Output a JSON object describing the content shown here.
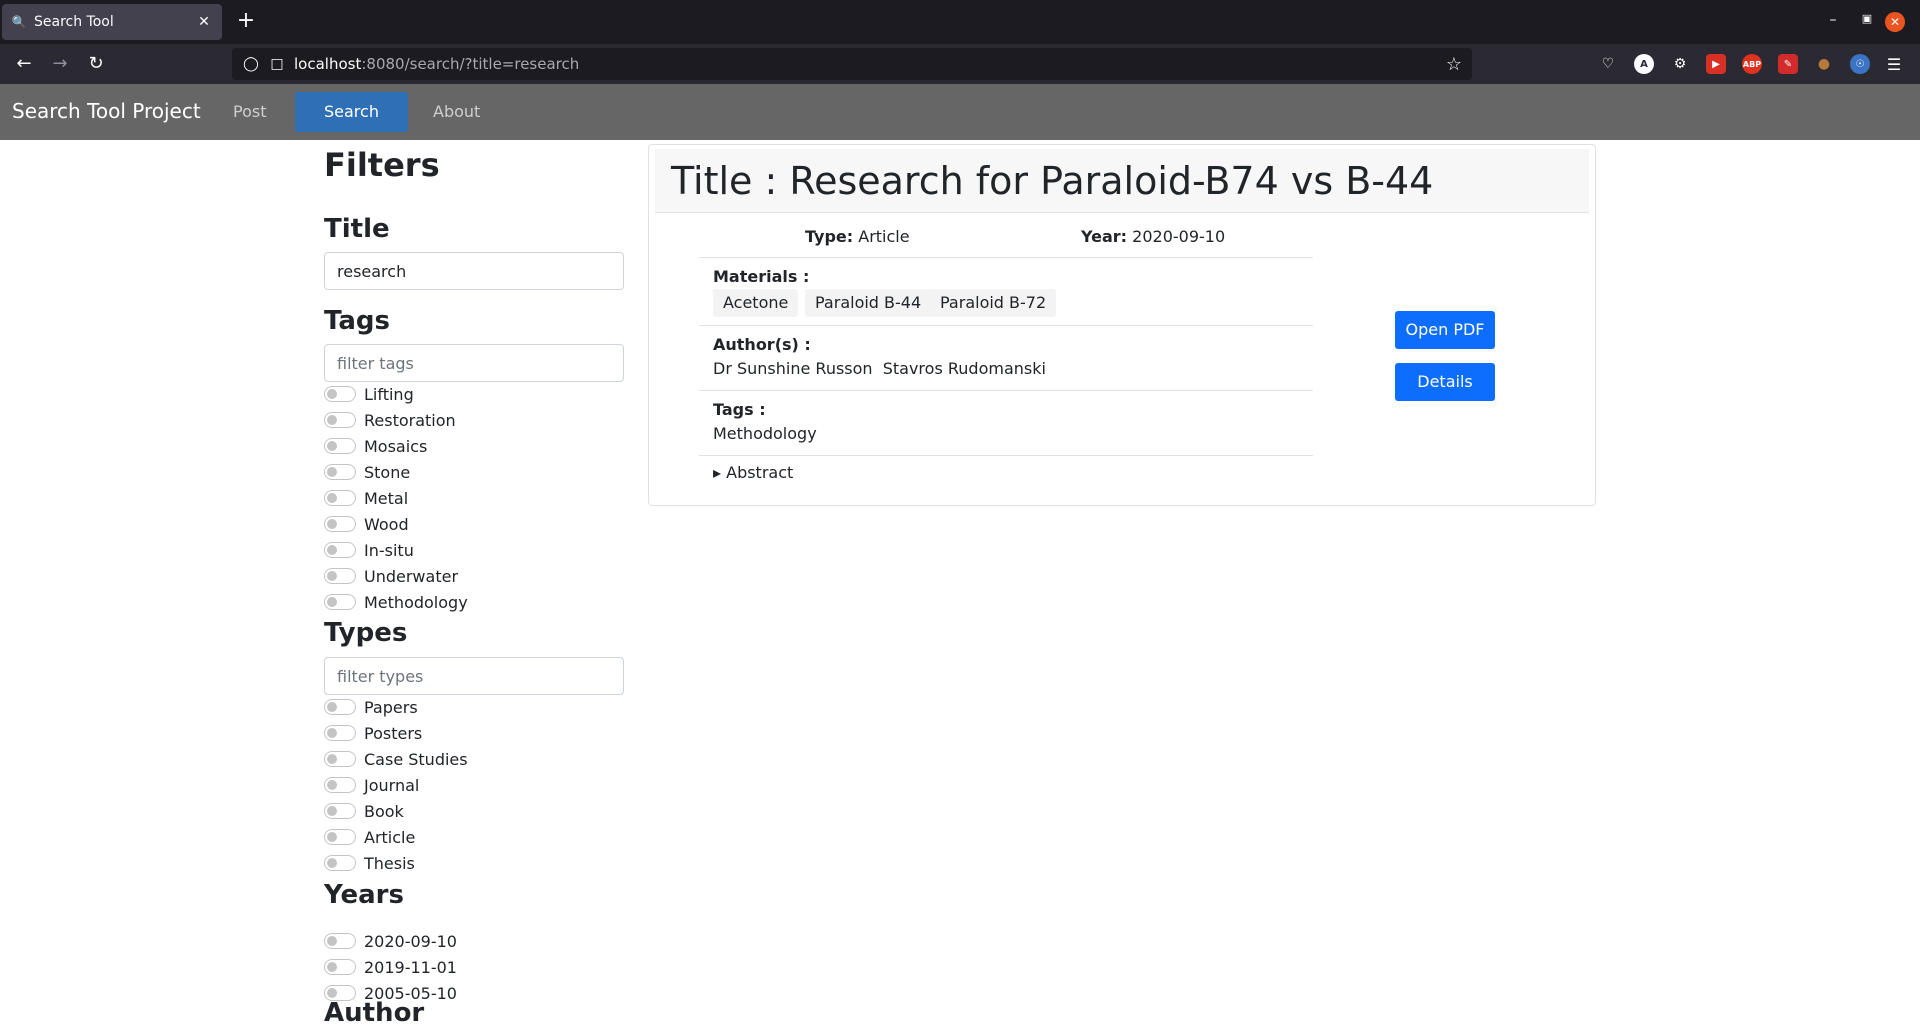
{
  "browser": {
    "tab_title": "Search Tool",
    "url_host": "localhost",
    "url_rest": ":8080/search/?title=research",
    "ext_abp": "ABP",
    "ext_a": "A"
  },
  "app": {
    "brand": "Search Tool Project",
    "nav": [
      {
        "label": "Post"
      },
      {
        "label": "Search"
      },
      {
        "label": "About"
      }
    ]
  },
  "filters": {
    "heading": "Filters",
    "title_heading": "Title",
    "title_value": "research",
    "tags_heading": "Tags",
    "tags_placeholder": "filter tags",
    "tags": [
      "Lifting",
      "Restoration",
      "Mosaics",
      "Stone",
      "Metal",
      "Wood",
      "In-situ",
      "Underwater",
      "Methodology"
    ],
    "types_heading": "Types",
    "types_placeholder": "filter types",
    "types": [
      "Papers",
      "Posters",
      "Case Studies",
      "Journal",
      "Book",
      "Article",
      "Thesis"
    ],
    "years_heading": "Years",
    "years": [
      "2020-09-10",
      "2019-11-01",
      "2005-05-10"
    ],
    "author_heading": "Author"
  },
  "result": {
    "title": "Title : Research for Paraloid-B74 vs B-44",
    "type_label": "Type:",
    "type_value": "Article",
    "year_label": "Year:",
    "year_value": "2020-09-10",
    "materials_label": "Materials :",
    "materials": [
      "Acetone",
      "Paraloid B-44",
      "Paraloid B-72"
    ],
    "authors_label": "Author(s) :",
    "authors": "Dr Sunshine Russon  Stavros Rudomanski",
    "tags_label": "Tags :",
    "tags": "Methodology",
    "abstract_label": "▸ Abstract",
    "open_pdf": "Open PDF",
    "details": "Details"
  }
}
